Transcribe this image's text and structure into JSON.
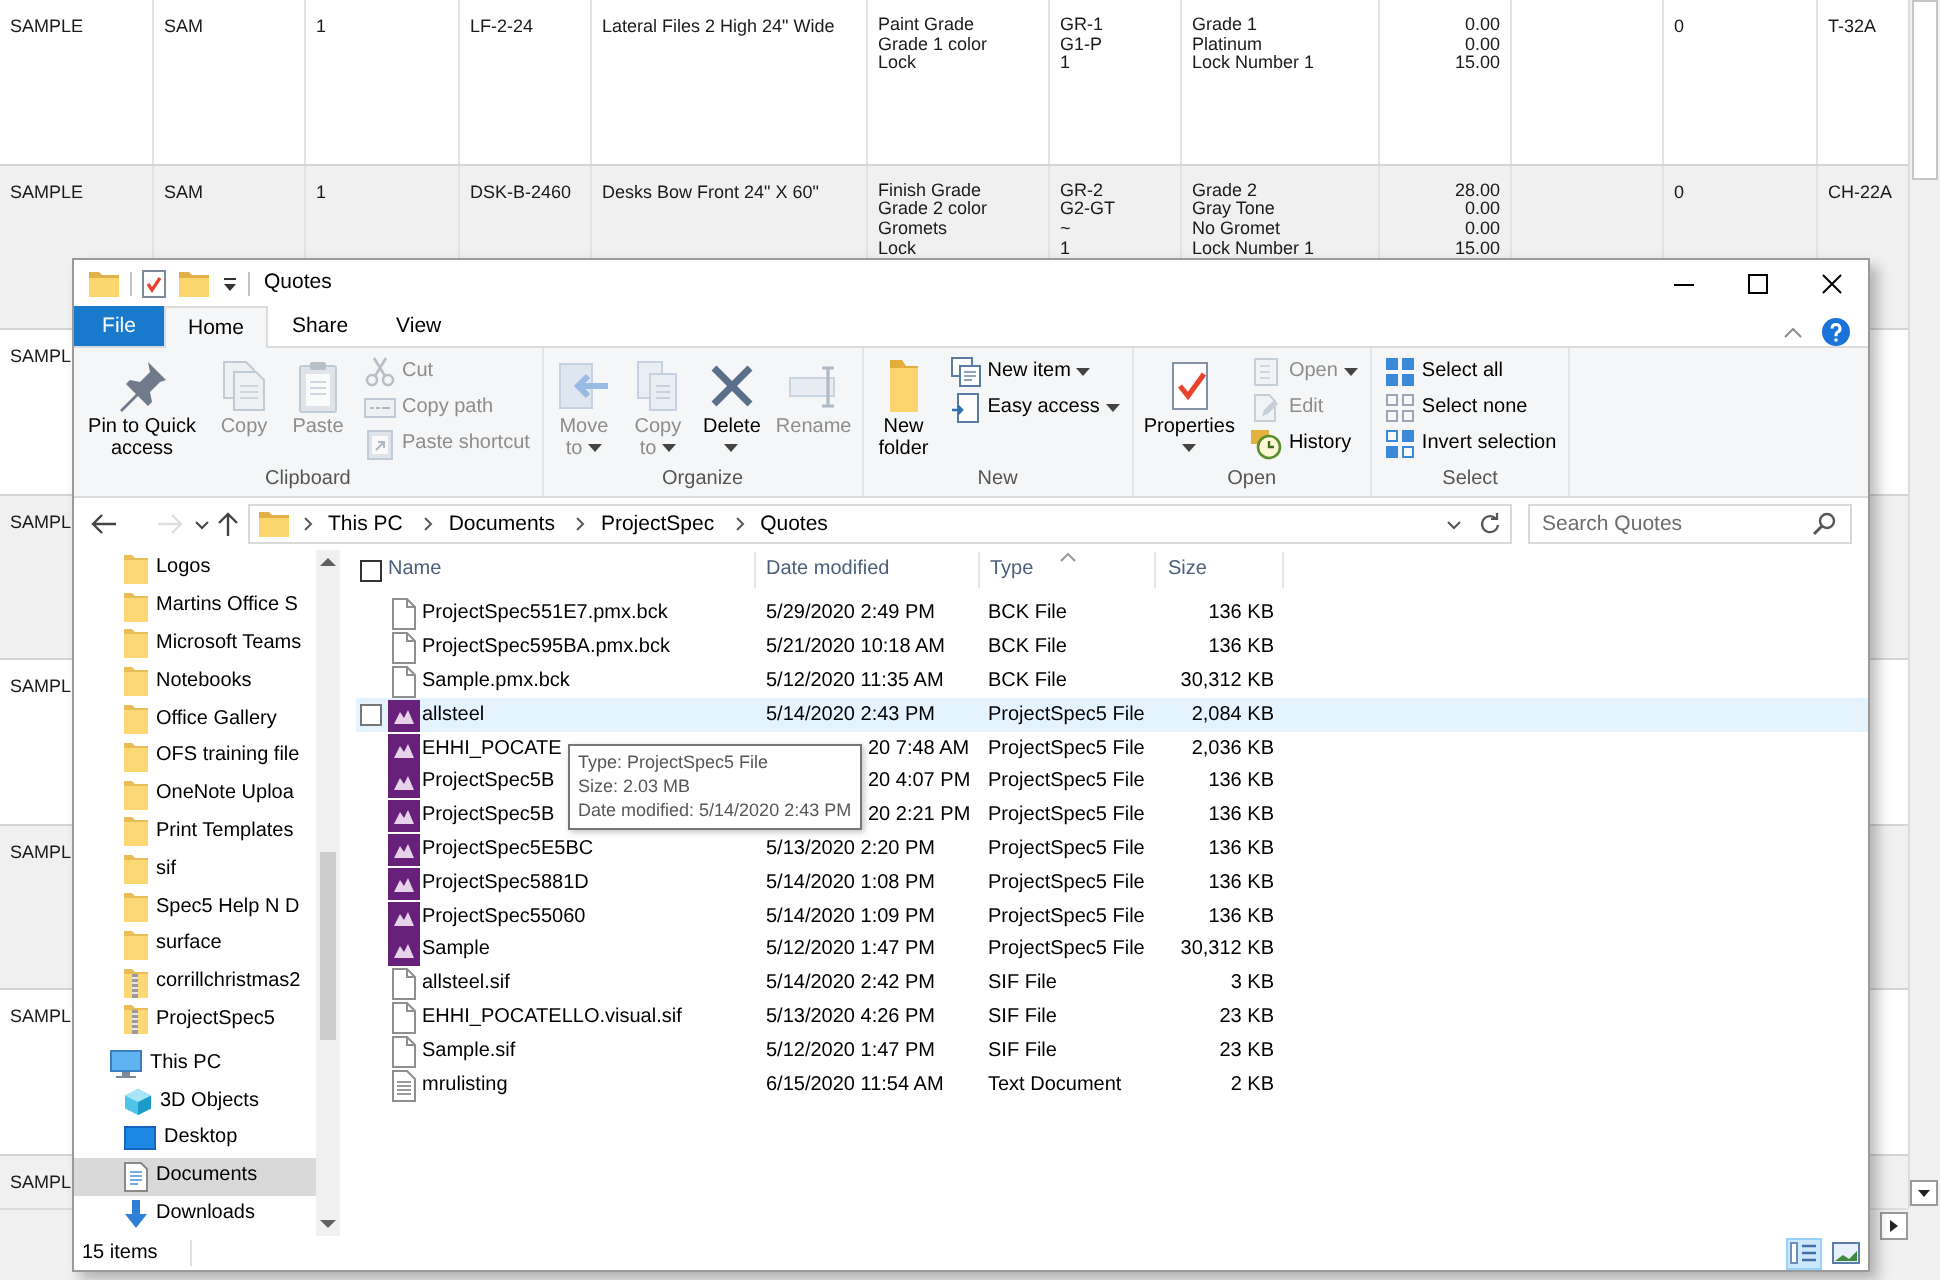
{
  "grid": {
    "rows": [
      {
        "column_1": "SAMPLE",
        "column_2": "SAM",
        "column_3": "1",
        "column_4": "LF-2-24",
        "column_5": "Lateral Files 2 High 24\" Wide",
        "column_6": "Paint Grade\nGrade 1 color\nLock",
        "column_7": "GR-1\nG1-P\n1",
        "column_8": "Grade 1\nPlatinum\nLock Number 1",
        "column_9": "0.00\n0.00\n15.00",
        "column_11": "0",
        "column_12": "T-32A"
      },
      {
        "column_1": "SAMPLE",
        "column_2": "SAM",
        "column_3": "1",
        "column_4": "DSK-B-2460",
        "column_5": "Desks Bow Front 24\" X 60\"",
        "column_6": "Finish Grade\nGrade 2 color\nGromets\nLock",
        "column_7": "GR-2\nG2-GT\n~\n1",
        "column_8": "Grade 2\nGray Tone\nNo Gromet\nLock Number 1",
        "column_9": "28.00\n0.00\n0.00\n15.00",
        "column_11": "0",
        "column_12": "CH-22A"
      },
      {
        "column_1": "SAMPL"
      },
      {
        "column_1": "SAMPL"
      },
      {
        "column_1": "SAMPL"
      },
      {
        "column_1": "SAMPL"
      },
      {
        "column_1": "SAMPL"
      },
      {
        "column_1": "SAMPL"
      }
    ]
  },
  "window": {
    "title": "Quotes"
  },
  "ribbon": {
    "tabs": [
      {
        "label": "File",
        "kind": "menu",
        "selected": false
      },
      {
        "label": "Home",
        "kind": "tab",
        "selected": true
      },
      {
        "label": "Share",
        "kind": "tab",
        "selected": false
      },
      {
        "label": "View",
        "kind": "tab",
        "selected": false
      }
    ],
    "groups": [
      {
        "label": "Clipboard",
        "buttons": [
          {
            "label": "Pin to Quick access",
            "kind": "large",
            "disabled": false,
            "dropdown": false
          },
          {
            "label": "Copy",
            "kind": "large",
            "disabled": true,
            "dropdown": false
          },
          {
            "label": "Paste",
            "kind": "large",
            "disabled": true,
            "dropdown": false
          },
          {
            "label": "Cut",
            "kind": "small",
            "disabled": true,
            "dropdown": false
          },
          {
            "label": "Copy path",
            "kind": "small",
            "disabled": true,
            "dropdown": false
          },
          {
            "label": "Paste shortcut",
            "kind": "small",
            "disabled": true,
            "dropdown": false
          }
        ]
      },
      {
        "label": "Organize",
        "buttons": [
          {
            "label": "Move to",
            "kind": "large",
            "disabled": true,
            "dropdown": true
          },
          {
            "label": "Copy to",
            "kind": "large",
            "disabled": true,
            "dropdown": true
          },
          {
            "label": "Delete",
            "kind": "large",
            "disabled": false,
            "dropdown": true
          },
          {
            "label": "Rename",
            "kind": "large",
            "disabled": true,
            "dropdown": false
          }
        ]
      },
      {
        "label": "New",
        "buttons": [
          {
            "label": "New folder",
            "kind": "large",
            "disabled": false,
            "dropdown": false
          },
          {
            "label": "New item",
            "kind": "small",
            "disabled": false,
            "dropdown": true
          },
          {
            "label": "Easy access",
            "kind": "small",
            "disabled": false,
            "dropdown": true
          }
        ]
      },
      {
        "label": "Open",
        "buttons": [
          {
            "label": "Properties",
            "kind": "large",
            "disabled": false,
            "dropdown": true
          },
          {
            "label": "Open",
            "kind": "small",
            "disabled": true,
            "dropdown": true
          },
          {
            "label": "Edit",
            "kind": "small",
            "disabled": true,
            "dropdown": false
          },
          {
            "label": "History",
            "kind": "small",
            "disabled": false,
            "dropdown": false
          }
        ]
      },
      {
        "label": "Select",
        "buttons": [
          {
            "label": "Select all",
            "kind": "small",
            "disabled": false,
            "dropdown": false
          },
          {
            "label": "Select none",
            "kind": "small",
            "disabled": false,
            "dropdown": false
          },
          {
            "label": "Invert selection",
            "kind": "small",
            "disabled": false,
            "dropdown": false
          }
        ]
      }
    ]
  },
  "nav_buttons": [
    {
      "kind": "back",
      "disabled": false
    },
    {
      "kind": "forward",
      "disabled": true
    },
    {
      "kind": "recent",
      "disabled": false
    },
    {
      "kind": "up",
      "disabled": false
    }
  ],
  "address_bar": {
    "breadcrumbs": [
      "This PC",
      "Documents",
      "ProjectSpec",
      "Quotes"
    ]
  },
  "search": {
    "placeholder": "Search Quotes"
  },
  "nav_pane": {
    "items": [
      {
        "children": [
          {
            "label": "Logos",
            "kind": "folder",
            "selected": false
          },
          {
            "label": "Martins Office S",
            "kind": "folder",
            "selected": false
          },
          {
            "label": "Microsoft Teams",
            "kind": "folder",
            "selected": false
          },
          {
            "label": "Notebooks",
            "kind": "folder",
            "selected": false
          },
          {
            "label": "Office Gallery",
            "kind": "folder",
            "selected": false
          },
          {
            "label": "OFS training file",
            "kind": "folder",
            "selected": false
          },
          {
            "label": "OneNote Uploa",
            "kind": "folder",
            "selected": false
          },
          {
            "label": "Print Templates",
            "kind": "folder",
            "selected": false
          },
          {
            "label": "sif",
            "kind": "folder",
            "selected": false
          },
          {
            "label": "Spec5 Help N D",
            "kind": "folder",
            "selected": false
          },
          {
            "label": "surface",
            "kind": "folder",
            "selected": false
          },
          {
            "label": "corrillchristmas2",
            "kind": "zip",
            "selected": false
          },
          {
            "label": "ProjectSpec5",
            "kind": "zip",
            "selected": false
          }
        ]
      },
      {
        "label": "This PC",
        "kind": "pc",
        "selected": false,
        "children": [
          {
            "label": "3D Objects",
            "kind": "objects",
            "selected": false
          },
          {
            "label": "Desktop",
            "kind": "desktop",
            "selected": false
          },
          {
            "label": "Documents",
            "kind": "documents",
            "selected": true
          },
          {
            "label": "Downloads",
            "kind": "downloads",
            "selected": false
          }
        ]
      }
    ]
  },
  "file_list": {
    "select_all": {
      "checked": false
    },
    "columns": [
      {
        "label": "Name",
        "sorted": false
      },
      {
        "label": "Date modified",
        "sorted": false
      },
      {
        "label": "Type",
        "sorted": true
      },
      {
        "label": "Size",
        "sorted": false
      }
    ],
    "rows": [
      {
        "name": "ProjectSpec551E7.pmx.bck",
        "date_modified": "5/29/2020 2:49 PM",
        "type": "BCK File",
        "size": "136 KB",
        "kind": "file",
        "hovered": false,
        "selected": false,
        "covered": false
      },
      {
        "name": "ProjectSpec595BA.pmx.bck",
        "date_modified": "5/21/2020 10:18 AM",
        "type": "BCK File",
        "size": "136 KB",
        "kind": "file",
        "hovered": false,
        "selected": false,
        "covered": false
      },
      {
        "name": "Sample.pmx.bck",
        "date_modified": "5/12/2020 11:35 AM",
        "type": "BCK File",
        "size": "30,312 KB",
        "kind": "file",
        "hovered": false,
        "selected": false,
        "covered": false
      },
      {
        "name": "allsteel",
        "date_modified": "5/14/2020 2:43 PM",
        "type": "ProjectSpec5 File",
        "size": "2,084 KB",
        "kind": "app",
        "hovered": true,
        "selected": false,
        "covered": false
      },
      {
        "name": "EHHI_POCATE",
        "date_modified": "20 7:48 AM",
        "type": "ProjectSpec5 File",
        "size": "2,036 KB",
        "kind": "app",
        "hovered": false,
        "selected": false,
        "covered": true
      },
      {
        "name": "ProjectSpec5B",
        "date_modified": "20 4:07 PM",
        "type": "ProjectSpec5 File",
        "size": "136 KB",
        "kind": "app",
        "hovered": false,
        "selected": false,
        "covered": true
      },
      {
        "name": "ProjectSpec5B",
        "date_modified": "20 2:21 PM",
        "type": "ProjectSpec5 File",
        "size": "136 KB",
        "kind": "app",
        "hovered": false,
        "selected": false,
        "covered": true
      },
      {
        "name": "ProjectSpec5E5BC",
        "date_modified": "5/13/2020 2:20 PM",
        "type": "ProjectSpec5 File",
        "size": "136 KB",
        "kind": "app",
        "hovered": false,
        "selected": false,
        "covered": false
      },
      {
        "name": "ProjectSpec5881D",
        "date_modified": "5/14/2020 1:08 PM",
        "type": "ProjectSpec5 File",
        "size": "136 KB",
        "kind": "app",
        "hovered": false,
        "selected": false,
        "covered": false
      },
      {
        "name": "ProjectSpec55060",
        "date_modified": "5/14/2020 1:09 PM",
        "type": "ProjectSpec5 File",
        "size": "136 KB",
        "kind": "app",
        "hovered": false,
        "selected": false,
        "covered": false
      },
      {
        "name": "Sample",
        "date_modified": "5/12/2020 1:47 PM",
        "type": "ProjectSpec5 File",
        "size": "30,312 KB",
        "kind": "app",
        "hovered": false,
        "selected": false,
        "covered": false
      },
      {
        "name": "allsteel.sif",
        "date_modified": "5/14/2020 2:42 PM",
        "type": "SIF File",
        "size": "3 KB",
        "kind": "file",
        "hovered": false,
        "selected": false,
        "covered": false
      },
      {
        "name": "EHHI_POCATELLO.visual.sif",
        "date_modified": "5/13/2020 4:26 PM",
        "type": "SIF File",
        "size": "23 KB",
        "kind": "file",
        "hovered": false,
        "selected": false,
        "covered": false
      },
      {
        "name": "Sample.sif",
        "date_modified": "5/12/2020 1:47 PM",
        "type": "SIF File",
        "size": "23 KB",
        "kind": "file",
        "hovered": false,
        "selected": false,
        "covered": false
      },
      {
        "name": "mrulisting",
        "date_modified": "6/15/2020 11:54 AM",
        "type": "Text Document",
        "size": "2 KB",
        "kind": "text",
        "hovered": false,
        "selected": false,
        "covered": false
      }
    ]
  },
  "tooltip": {
    "lines": [
      "Type: ProjectSpec5 File",
      "Size: 2.03 MB",
      "Date modified: 5/14/2020 2:43 PM"
    ]
  },
  "status_bar": {
    "text": "15 items",
    "views": [
      {
        "kind": "details",
        "selected": true
      },
      {
        "kind": "icons",
        "selected": false
      }
    ]
  }
}
